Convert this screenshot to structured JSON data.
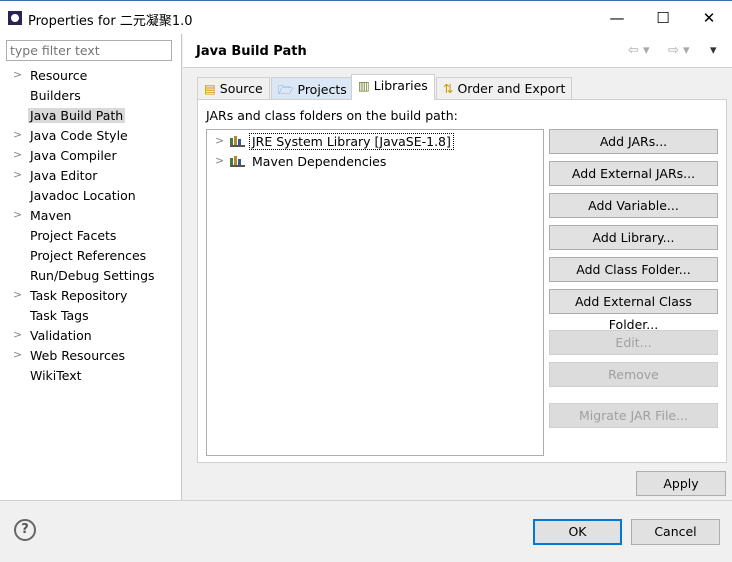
{
  "window": {
    "title": "Properties for 二元凝聚1.0",
    "minimize": "—",
    "maximize": "☐",
    "close": "✕"
  },
  "sidebar": {
    "filter_placeholder": "type filter text",
    "items": [
      {
        "label": "Resource",
        "expandable": true
      },
      {
        "label": "Builders",
        "expandable": false
      },
      {
        "label": "Java Build Path",
        "expandable": false,
        "selected": true
      },
      {
        "label": "Java Code Style",
        "expandable": true
      },
      {
        "label": "Java Compiler",
        "expandable": true
      },
      {
        "label": "Java Editor",
        "expandable": true
      },
      {
        "label": "Javadoc Location",
        "expandable": false
      },
      {
        "label": "Maven",
        "expandable": true
      },
      {
        "label": "Project Facets",
        "expandable": false
      },
      {
        "label": "Project References",
        "expandable": false
      },
      {
        "label": "Run/Debug Settings",
        "expandable": false
      },
      {
        "label": "Task Repository",
        "expandable": true
      },
      {
        "label": "Task Tags",
        "expandable": false
      },
      {
        "label": "Validation",
        "expandable": true
      },
      {
        "label": "Web Resources",
        "expandable": true
      },
      {
        "label": "WikiText",
        "expandable": false
      }
    ]
  },
  "page": {
    "title": "Java Build Path",
    "tabs": [
      {
        "label": "Source"
      },
      {
        "label": "Projects"
      },
      {
        "label": "Libraries",
        "active": true
      },
      {
        "label": "Order and Export"
      }
    ],
    "caption": "JARs and class folders on the build path:",
    "entries": [
      {
        "label": "JRE System Library [JavaSE-1.8]"
      },
      {
        "label": "Maven Dependencies"
      }
    ],
    "buttons": [
      {
        "label": "Add JARs...",
        "enabled": true
      },
      {
        "label": "Add External JARs...",
        "enabled": true
      },
      {
        "label": "Add Variable...",
        "enabled": true
      },
      {
        "label": "Add Library...",
        "enabled": true
      },
      {
        "label": "Add Class Folder...",
        "enabled": true
      },
      {
        "label": "Add External Class Folder...",
        "enabled": true
      },
      {
        "label": "Edit...",
        "enabled": false
      },
      {
        "label": "Remove",
        "enabled": false
      },
      {
        "label": "Migrate JAR File...",
        "enabled": false
      }
    ],
    "apply": "Apply"
  },
  "footer": {
    "help": "?",
    "ok": "OK",
    "cancel": "Cancel"
  }
}
